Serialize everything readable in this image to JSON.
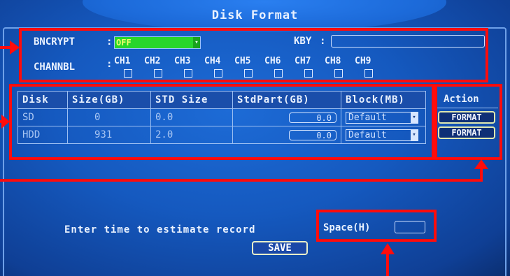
{
  "window": {
    "title": "Disk Format"
  },
  "encrypt": {
    "label": "BNCRYPT",
    "colon": ":",
    "value": "OFF"
  },
  "key": {
    "label": "KBY",
    "colon": ":",
    "value": ""
  },
  "channel": {
    "label": "CHANNBL",
    "colon": ":",
    "items": [
      "CH1",
      "CH2",
      "CH3",
      "CH4",
      "CH5",
      "CH6",
      "CH7",
      "CH8",
      "CH9"
    ]
  },
  "table": {
    "headers": [
      "Disk",
      "Size(GB)",
      "STD Size",
      "StdPart(GB)",
      "Block(MB)"
    ],
    "rows": [
      {
        "disk": "SD",
        "size": "0",
        "std_size": "0.0",
        "std_part": "0.0",
        "block": "Default"
      },
      {
        "disk": "HDD",
        "size": "931",
        "std_size": "2.0",
        "std_part": "0.0",
        "block": "Default"
      }
    ]
  },
  "action": {
    "header": "Action",
    "format_label": "FORMAT"
  },
  "footer": {
    "estimate_label": "Enter time to estimate record",
    "space_label": "Space(H)",
    "space_value": "",
    "save_label": "SAVE"
  },
  "colors": {
    "annotation": "#ff0c0c",
    "encrypt_bg": "#28d62b",
    "background": "#1559bf"
  }
}
